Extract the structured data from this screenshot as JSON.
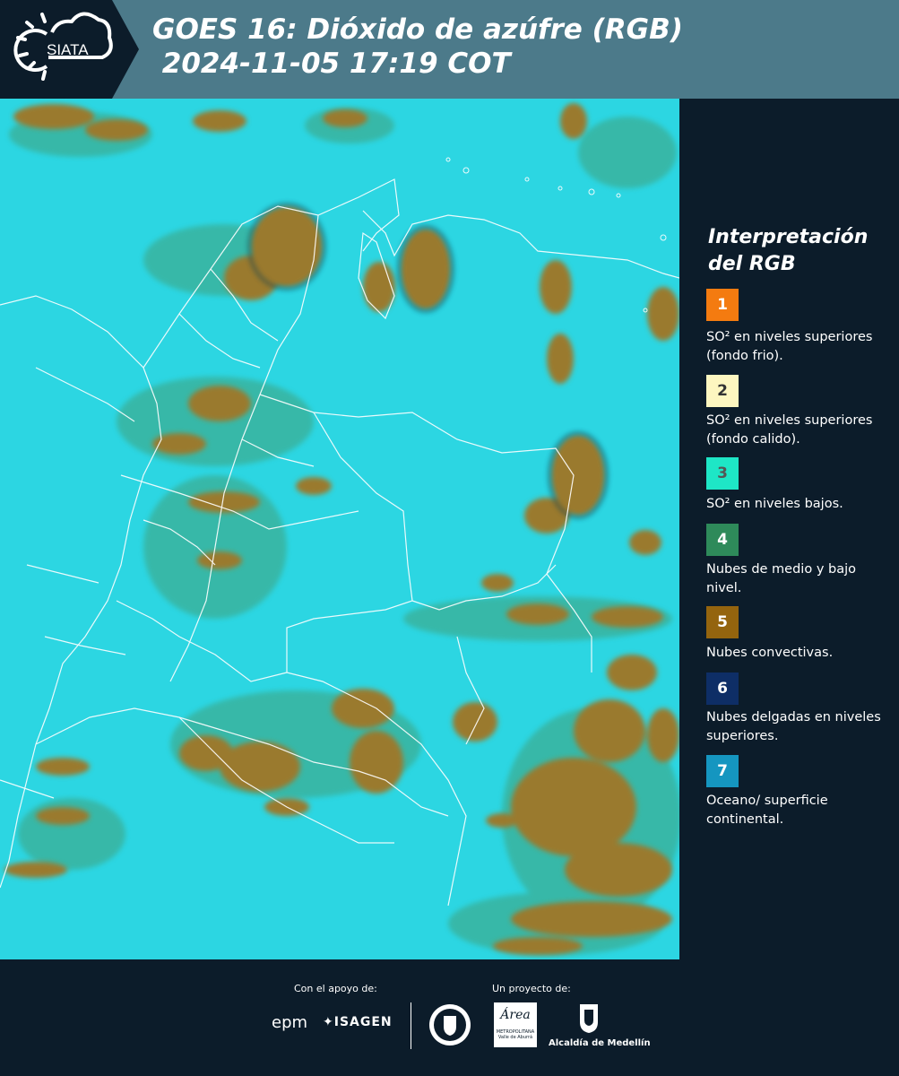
{
  "header": {
    "logo_text": "SIATA",
    "title": "GOES 16: Dióxido de azúfre (RGB)\n 2024-11-05 17:19 COT"
  },
  "legend": {
    "title": "Interpretación\ndel RGB",
    "items": [
      {
        "num": "1",
        "color": "#f47b10",
        "text": "SO² en niveles superiores (fondo frio)."
      },
      {
        "num": "2",
        "color": "#fdf6c0",
        "text": "SO² en niveles superiores (fondo calido)."
      },
      {
        "num": "3",
        "color": "#1ee6c6",
        "text": "SO² en niveles bajos."
      },
      {
        "num": "4",
        "color": "#2e8a5a",
        "text": "Nubes de medio y bajo nivel."
      },
      {
        "num": "5",
        "color": "#94640e",
        "text": "Nubes convectivas."
      },
      {
        "num": "6",
        "color": "#0e2e66",
        "text": "Nubes delgadas en niveles superiores."
      },
      {
        "num": "7",
        "color": "#1596c0",
        "text": "Oceano/ superficie continental."
      }
    ]
  },
  "footer": {
    "support_label": "Con el apoyo de:",
    "project_label": "Un proyecto de:",
    "epm": "epm",
    "isagen": "ISAGEN",
    "area_script": "Área",
    "area_line1": "METROPOLITANA",
    "area_line2": "Valle de Aburrá",
    "alcaldia": "Alcaldía de Medellín"
  }
}
